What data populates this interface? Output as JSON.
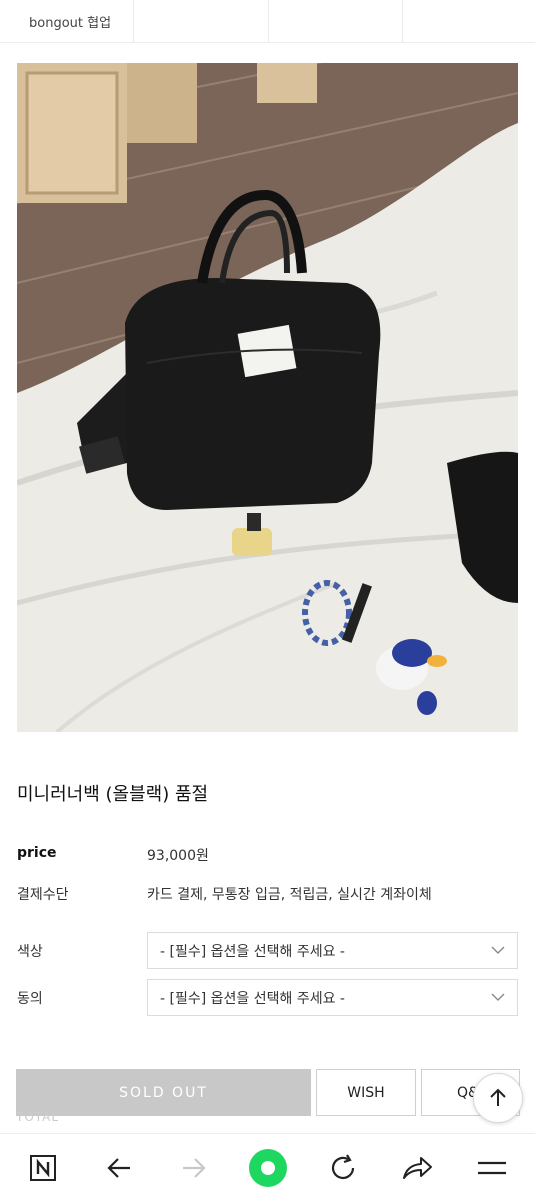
{
  "topbar": {
    "tabs": [
      "bongout 협업",
      "",
      "",
      ""
    ]
  },
  "product": {
    "title": "미니러너백 (올블랙) 품절",
    "price_label": "price",
    "price_value": "93,000원",
    "payment_label": "결제수단",
    "payment_value": "카드 결제, 무통장 입금, 적립금, 실시간 계좌이체"
  },
  "options": [
    {
      "label": "색상",
      "placeholder": "- [필수] 옵션을 선택해 주세요 -"
    },
    {
      "label": "동의",
      "placeholder": "- [필수] 옵션을 선택해 주세요 -"
    }
  ],
  "actions": {
    "soldout_label": "SOLD OUT",
    "wish_label": "WISH",
    "qa_label": "Q&A",
    "total_label": "TOTAL"
  },
  "bottom_nav": {
    "icons": [
      "naver-n-icon",
      "back-arrow-icon",
      "forward-arrow-icon",
      "home-circle-icon",
      "refresh-icon",
      "share-icon",
      "menu-icon"
    ],
    "accent": "#1ed760"
  }
}
